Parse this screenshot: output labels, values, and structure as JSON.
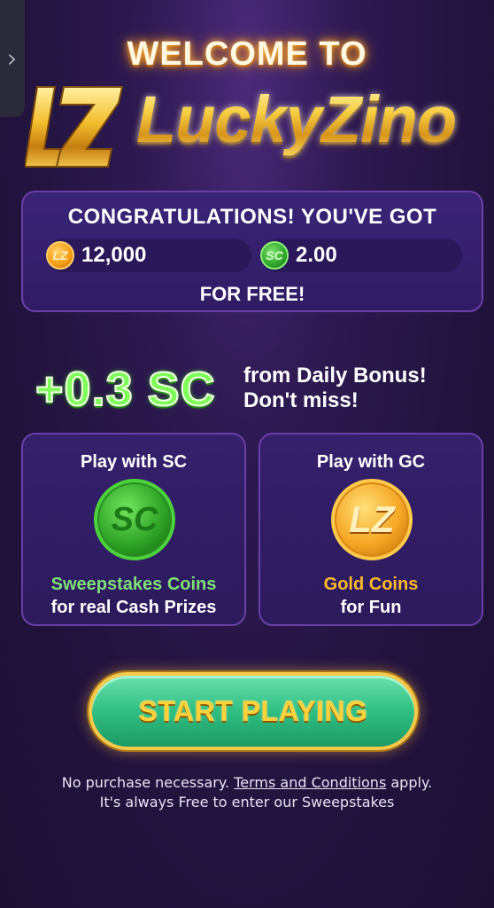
{
  "side_tab": {
    "glyph": "›"
  },
  "header": {
    "welcome": "WELCOME TO",
    "logo_badge": "LZ",
    "logo_text": "LuckyZino"
  },
  "congrats": {
    "title": "CONGRATULATIONS! YOU'VE GOT",
    "gold_coin_icon": "LZ",
    "gold_amount": "12,000",
    "sc_coin_icon": "SC",
    "sc_amount": "2.00",
    "footer": "FOR FREE!"
  },
  "bonus": {
    "amount": "+0.3 SC",
    "text": "from Daily Bonus!\nDon't miss!"
  },
  "modes": [
    {
      "title": "Play with SC",
      "coin": "SC",
      "subtitle": "Sweepstakes Coins",
      "description": "for real Cash Prizes"
    },
    {
      "title": "Play with GC",
      "coin": "LZ",
      "subtitle": "Gold Coins",
      "description": "for Fun"
    }
  ],
  "cta": {
    "label": "START PLAYING"
  },
  "disclaimer": {
    "prefix": "No purchase necessary.",
    "terms_link": "Terms and Conditions",
    "suffix": "apply.",
    "line2": "It's always Free to enter our Sweepstakes"
  },
  "colors": {
    "background": "#231440",
    "card": "#35206c",
    "card_border": "#6a3fa8",
    "gold": "#f4c43a",
    "green_accent": "#7fe07a",
    "orange_accent": "#ffb92a",
    "button_green": "#2fbf83"
  }
}
